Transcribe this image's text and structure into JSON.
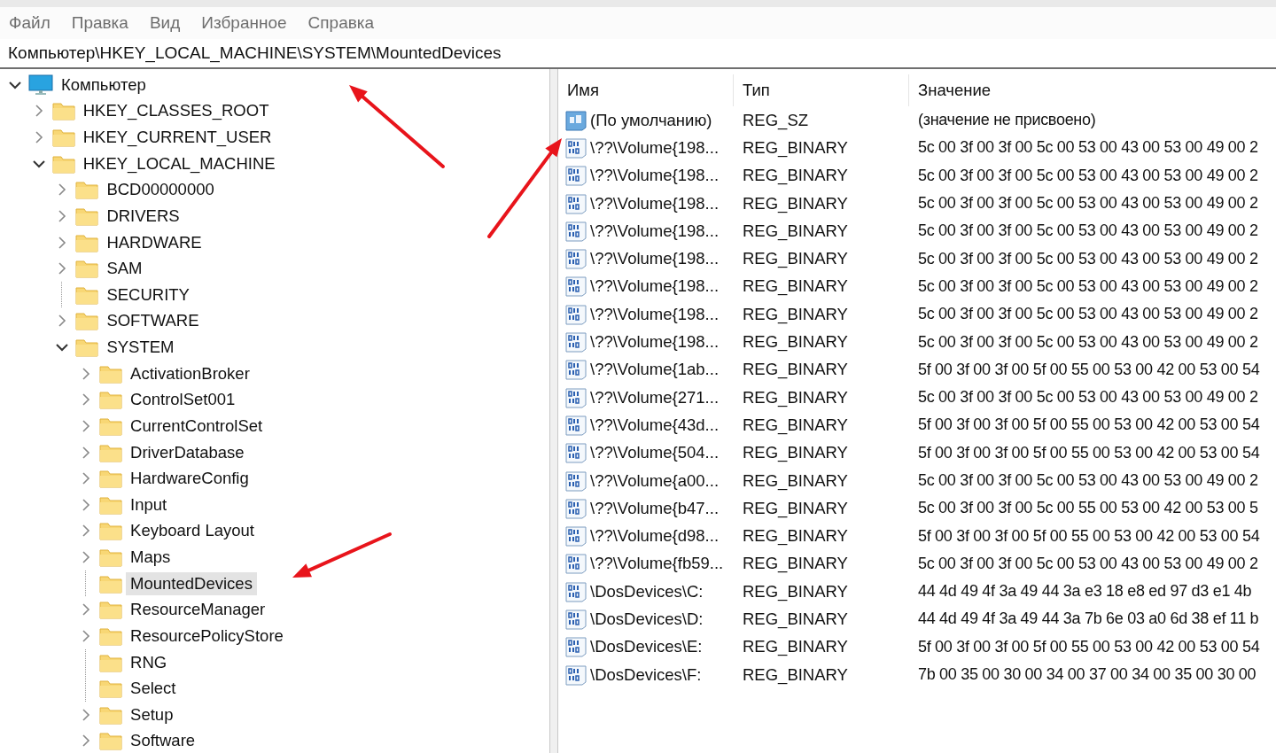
{
  "menu": [
    "Файл",
    "Правка",
    "Вид",
    "Избранное",
    "Справка"
  ],
  "address": "Компьютер\\HKEY_LOCAL_MACHINE\\SYSTEM\\MountedDevices",
  "tree": [
    {
      "label": "Компьютер",
      "kind": "branch",
      "expanded": true,
      "selected": false,
      "children": [
        {
          "label": "HKEY_CLASSES_ROOT",
          "kind": "branch",
          "expanded": false,
          "selected": false
        },
        {
          "label": "HKEY_CURRENT_USER",
          "kind": "branch",
          "expanded": false,
          "selected": false
        },
        {
          "label": "HKEY_LOCAL_MACHINE",
          "kind": "branch",
          "expanded": true,
          "selected": false,
          "children": [
            {
              "label": "BCD00000000",
              "kind": "branch",
              "expanded": false,
              "selected": false
            },
            {
              "label": "DRIVERS",
              "kind": "branch",
              "expanded": false,
              "selected": false
            },
            {
              "label": "HARDWARE",
              "kind": "branch",
              "expanded": false,
              "selected": false
            },
            {
              "label": "SAM",
              "kind": "branch",
              "expanded": false,
              "selected": false
            },
            {
              "label": "SECURITY",
              "kind": "leaf",
              "selected": false
            },
            {
              "label": "SOFTWARE",
              "kind": "branch",
              "expanded": false,
              "selected": false
            },
            {
              "label": "SYSTEM",
              "kind": "branch",
              "expanded": true,
              "selected": false,
              "children": [
                {
                  "label": "ActivationBroker",
                  "kind": "branch",
                  "expanded": false,
                  "selected": false
                },
                {
                  "label": "ControlSet001",
                  "kind": "branch",
                  "expanded": false,
                  "selected": false
                },
                {
                  "label": "CurrentControlSet",
                  "kind": "branch",
                  "expanded": false,
                  "selected": false
                },
                {
                  "label": "DriverDatabase",
                  "kind": "branch",
                  "expanded": false,
                  "selected": false
                },
                {
                  "label": "HardwareConfig",
                  "kind": "branch",
                  "expanded": false,
                  "selected": false
                },
                {
                  "label": "Input",
                  "kind": "branch",
                  "expanded": false,
                  "selected": false
                },
                {
                  "label": "Keyboard Layout",
                  "kind": "branch",
                  "expanded": false,
                  "selected": false
                },
                {
                  "label": "Maps",
                  "kind": "branch",
                  "expanded": false,
                  "selected": false
                },
                {
                  "label": "MountedDevices",
                  "kind": "leaf",
                  "selected": true
                },
                {
                  "label": "ResourceManager",
                  "kind": "branch",
                  "expanded": false,
                  "selected": false
                },
                {
                  "label": "ResourcePolicyStore",
                  "kind": "branch",
                  "expanded": false,
                  "selected": false
                },
                {
                  "label": "RNG",
                  "kind": "leaf",
                  "selected": false
                },
                {
                  "label": "Select",
                  "kind": "leaf",
                  "selected": false
                },
                {
                  "label": "Setup",
                  "kind": "branch",
                  "expanded": false,
                  "selected": false
                },
                {
                  "label": "Software",
                  "kind": "branch",
                  "expanded": false,
                  "selected": false
                }
              ]
            }
          ]
        }
      ]
    }
  ],
  "table": {
    "columns": [
      "Имя",
      "Тип",
      "Значение"
    ],
    "rows": [
      {
        "kind": "string",
        "name": "(По умолчанию)",
        "type": "REG_SZ",
        "value": "(значение не присвоено)"
      },
      {
        "kind": "binary",
        "name": "\\??\\Volume{198...",
        "type": "REG_BINARY",
        "value": "5c 00 3f 00 3f 00 5c 00 53 00 43 00 53 00 49 00 2"
      },
      {
        "kind": "binary",
        "name": "\\??\\Volume{198...",
        "type": "REG_BINARY",
        "value": "5c 00 3f 00 3f 00 5c 00 53 00 43 00 53 00 49 00 2"
      },
      {
        "kind": "binary",
        "name": "\\??\\Volume{198...",
        "type": "REG_BINARY",
        "value": "5c 00 3f 00 3f 00 5c 00 53 00 43 00 53 00 49 00 2"
      },
      {
        "kind": "binary",
        "name": "\\??\\Volume{198...",
        "type": "REG_BINARY",
        "value": "5c 00 3f 00 3f 00 5c 00 53 00 43 00 53 00 49 00 2"
      },
      {
        "kind": "binary",
        "name": "\\??\\Volume{198...",
        "type": "REG_BINARY",
        "value": "5c 00 3f 00 3f 00 5c 00 53 00 43 00 53 00 49 00 2"
      },
      {
        "kind": "binary",
        "name": "\\??\\Volume{198...",
        "type": "REG_BINARY",
        "value": "5c 00 3f 00 3f 00 5c 00 53 00 43 00 53 00 49 00 2"
      },
      {
        "kind": "binary",
        "name": "\\??\\Volume{198...",
        "type": "REG_BINARY",
        "value": "5c 00 3f 00 3f 00 5c 00 53 00 43 00 53 00 49 00 2"
      },
      {
        "kind": "binary",
        "name": "\\??\\Volume{198...",
        "type": "REG_BINARY",
        "value": "5c 00 3f 00 3f 00 5c 00 53 00 43 00 53 00 49 00 2"
      },
      {
        "kind": "binary",
        "name": "\\??\\Volume{1ab...",
        "type": "REG_BINARY",
        "value": "5f 00 3f 00 3f 00 5f 00 55 00 53 00 42 00 53 00 54"
      },
      {
        "kind": "binary",
        "name": "\\??\\Volume{271...",
        "type": "REG_BINARY",
        "value": "5c 00 3f 00 3f 00 5c 00 53 00 43 00 53 00 49 00 2"
      },
      {
        "kind": "binary",
        "name": "\\??\\Volume{43d...",
        "type": "REG_BINARY",
        "value": "5f 00 3f 00 3f 00 5f 00 55 00 53 00 42 00 53 00 54"
      },
      {
        "kind": "binary",
        "name": "\\??\\Volume{504...",
        "type": "REG_BINARY",
        "value": "5f 00 3f 00 3f 00 5f 00 55 00 53 00 42 00 53 00 54"
      },
      {
        "kind": "binary",
        "name": "\\??\\Volume{a00...",
        "type": "REG_BINARY",
        "value": "5c 00 3f 00 3f 00 5c 00 53 00 43 00 53 00 49 00 2"
      },
      {
        "kind": "binary",
        "name": "\\??\\Volume{b47...",
        "type": "REG_BINARY",
        "value": "5c 00 3f 00 3f 00 5c 00 55 00 53 00 42 00 53 00 5"
      },
      {
        "kind": "binary",
        "name": "\\??\\Volume{d98...",
        "type": "REG_BINARY",
        "value": "5f 00 3f 00 3f 00 5f 00 55 00 53 00 42 00 53 00 54"
      },
      {
        "kind": "binary",
        "name": "\\??\\Volume{fb59...",
        "type": "REG_BINARY",
        "value": "5c 00 3f 00 3f 00 5c 00 53 00 43 00 53 00 49 00 2"
      },
      {
        "kind": "binary",
        "name": "\\DosDevices\\C:",
        "type": "REG_BINARY",
        "value": "44 4d 49 4f 3a 49 44 3a e3 18 e8 ed 97 d3 e1 4b"
      },
      {
        "kind": "binary",
        "name": "\\DosDevices\\D:",
        "type": "REG_BINARY",
        "value": "44 4d 49 4f 3a 49 44 3a 7b 6e 03 a0 6d 38 ef 11 b"
      },
      {
        "kind": "binary",
        "name": "\\DosDevices\\E:",
        "type": "REG_BINARY",
        "value": "5f 00 3f 00 3f 00 5f 00 55 00 53 00 42 00 53 00 54"
      },
      {
        "kind": "binary",
        "name": "\\DosDevices\\F:",
        "type": "REG_BINARY",
        "value": "7b 00 35 00 30 00 34 00 37 00 34 00 35 00 30 00"
      }
    ]
  }
}
